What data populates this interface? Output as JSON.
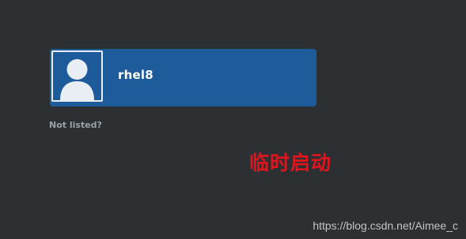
{
  "login": {
    "user": {
      "name": "rhel8",
      "avatar_icon": "default-user-avatar-icon",
      "highlight_color": "#1e5b9a"
    },
    "not_listed_label": "Not listed?"
  },
  "annotation": {
    "text": "临时启动",
    "color": "#e0151d"
  },
  "watermark": {
    "text": "https://blog.csdn.net/Aimee_c"
  },
  "colors": {
    "background": "#2c3032"
  }
}
